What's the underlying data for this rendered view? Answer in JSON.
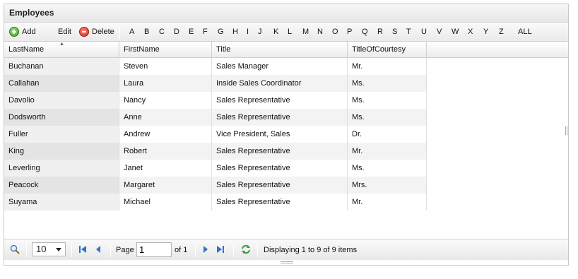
{
  "panel": {
    "title": "Employees"
  },
  "toolbar": {
    "add_label": "Add",
    "edit_label": "Edit",
    "delete_label": "Delete",
    "letters": [
      "A",
      "B",
      "C",
      "D",
      "E",
      "F",
      "G",
      "H",
      "I",
      "J",
      "K",
      "L",
      "M",
      "N",
      "O",
      "P",
      "Q",
      "R",
      "S",
      "T",
      "U",
      "V",
      "W",
      "X",
      "Y",
      "Z",
      "ALL"
    ]
  },
  "table": {
    "columns": [
      "LastName",
      "FirstName",
      "Title",
      "TitleOfCourtesy"
    ],
    "sorted_column": "LastName",
    "rows": [
      [
        "Buchanan",
        "Steven",
        "Sales Manager",
        "Mr."
      ],
      [
        "Callahan",
        "Laura",
        "Inside Sales Coordinator",
        "Ms."
      ],
      [
        "Davolio",
        "Nancy",
        "Sales Representative",
        "Ms."
      ],
      [
        "Dodsworth",
        "Anne",
        "Sales Representative",
        "Ms."
      ],
      [
        "Fuller",
        "Andrew",
        "Vice President, Sales",
        "Dr."
      ],
      [
        "King",
        "Robert",
        "Sales Representative",
        "Mr."
      ],
      [
        "Leverling",
        "Janet",
        "Sales Representative",
        "Ms."
      ],
      [
        "Peacock",
        "Margaret",
        "Sales Representative",
        "Mrs."
      ],
      [
        "Suyama",
        "Michael",
        "Sales Representative",
        "Mr."
      ]
    ]
  },
  "pager": {
    "page_size": "10",
    "page_label": "Page",
    "page_value": "1",
    "of_label": "of 1",
    "status": "Displaying 1 to 9 of 9 items"
  },
  "colors": {
    "add_icon": "#3c9a22",
    "delete_icon": "#d4261a",
    "nav_arrow": "#2f73c8",
    "refresh_icon": "#3a9a3a"
  }
}
